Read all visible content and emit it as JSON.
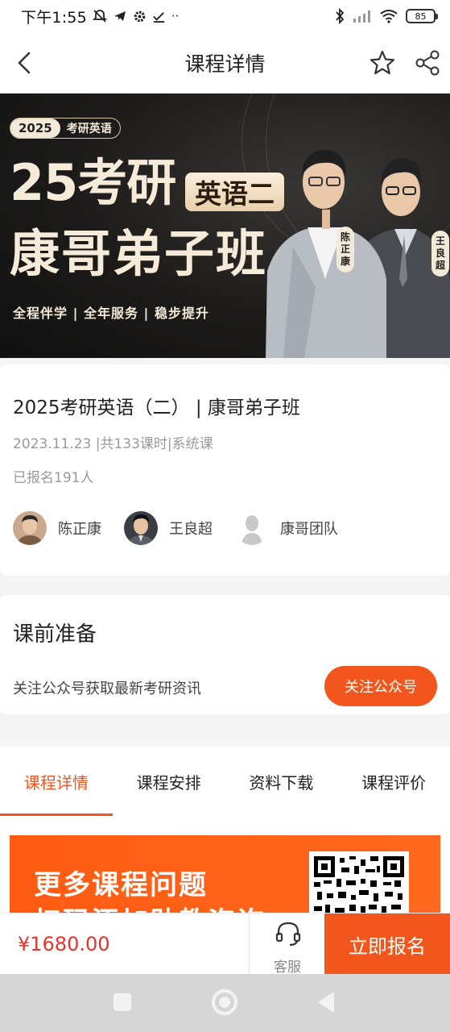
{
  "status_bar": {
    "time": "下午1:55",
    "battery": "85",
    "icons": [
      "mute-bell-icon",
      "telegram-icon",
      "gear-icon",
      "check-icon",
      "more-dots-icon",
      "bluetooth-icon",
      "signal-icon",
      "wifi-icon",
      "battery-icon"
    ]
  },
  "navbar": {
    "title": "课程详情"
  },
  "banner": {
    "chip_year": "2025",
    "chip_text": "考研英语",
    "line1": "25考研",
    "badge": "英语二",
    "line2": "康哥弟子班",
    "subtitle": "全程伴学 | 全年服务 | 稳步提升",
    "tag_left": "陈正康",
    "tag_right": "王良超"
  },
  "course": {
    "title": "2025考研英语（二） | 康哥弟子班",
    "meta": "2023.11.23 |共133课时|系统课",
    "enrolled": "已报名191人",
    "teachers": [
      {
        "name": "陈正康"
      },
      {
        "name": "王良超"
      },
      {
        "name": "康哥团队"
      }
    ]
  },
  "prep": {
    "title": "课前准备",
    "desc": "关注公众号获取最新考研资讯",
    "button": "关注公众号"
  },
  "tabs": [
    {
      "label": "课程详情",
      "active": true
    },
    {
      "label": "课程安排",
      "active": false
    },
    {
      "label": "资料下载",
      "active": false
    },
    {
      "label": "课程评价",
      "active": false
    }
  ],
  "promo": {
    "line1": "更多课程问题",
    "line2": "扫码添加助教咨询"
  },
  "bottom": {
    "price": "¥1680.00",
    "service_label": "客服",
    "enroll_button": "立即报名"
  },
  "colors": {
    "accent": "#f2561d",
    "price": "#e3352b"
  }
}
